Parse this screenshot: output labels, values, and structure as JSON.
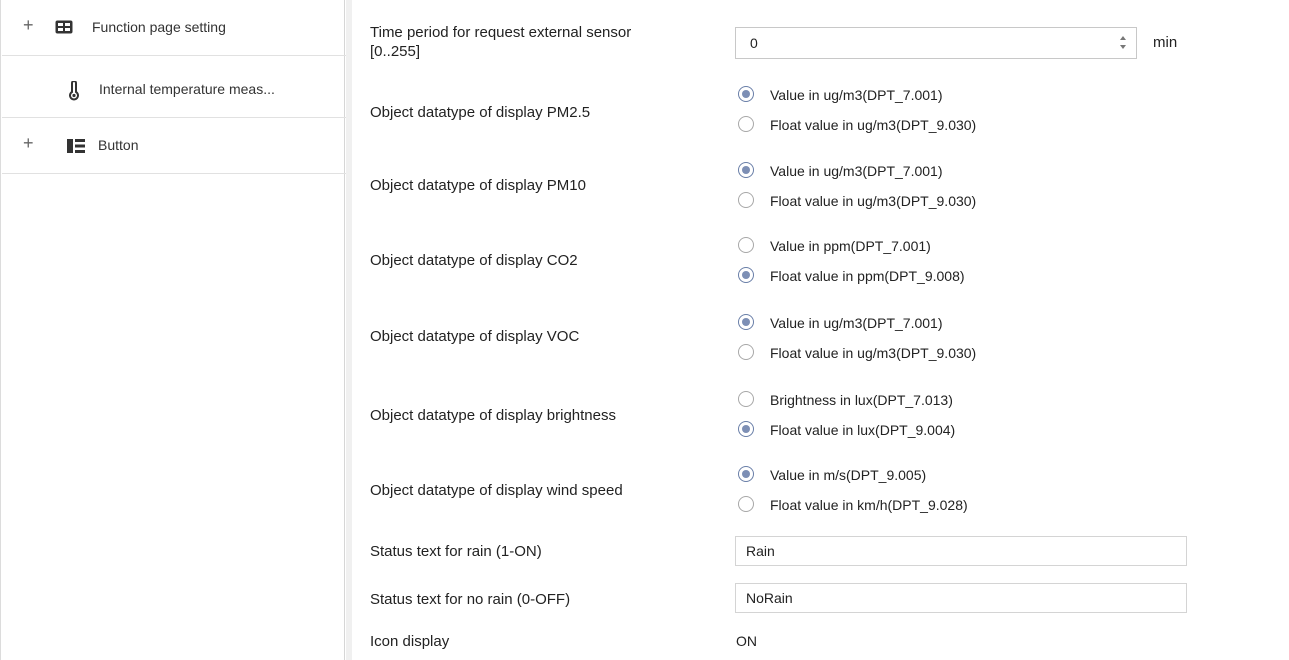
{
  "sidebar": {
    "items": [
      {
        "label": "Function page setting",
        "expander": "+",
        "icon": "grid-icon"
      },
      {
        "label": "Internal temperature meas...",
        "expander": "",
        "icon": "thermometer-icon"
      },
      {
        "label": "Button",
        "expander": "+",
        "icon": "layout-icon"
      }
    ]
  },
  "form": {
    "request_period": {
      "label_line1": "Time period for request external sensor",
      "label_line2": "[0..255]",
      "value": "0",
      "unit": "min"
    },
    "pm25": {
      "label": "Object datatype of display PM2.5",
      "options": [
        "Value in ug/m3(DPT_7.001)",
        "Float value in ug/m3(DPT_9.030)"
      ],
      "selected": 0
    },
    "pm10": {
      "label": "Object datatype of display PM10",
      "options": [
        "Value in ug/m3(DPT_7.001)",
        "Float value in ug/m3(DPT_9.030)"
      ],
      "selected": 0
    },
    "co2": {
      "label": "Object datatype of display CO2",
      "options": [
        "Value in ppm(DPT_7.001)",
        "Float value in ppm(DPT_9.008)"
      ],
      "selected": 1
    },
    "voc": {
      "label": "Object datatype of display VOC",
      "options": [
        "Value in ug/m3(DPT_7.001)",
        "Float value in ug/m3(DPT_9.030)"
      ],
      "selected": 0
    },
    "brightness": {
      "label": "Object datatype of display brightness",
      "options": [
        "Brightness in lux(DPT_7.013)",
        "Float value in lux(DPT_9.004)"
      ],
      "selected": 1
    },
    "wind": {
      "label": "Object datatype of display wind speed",
      "options": [
        "Value in m/s(DPT_9.005)",
        "Float value in km/h(DPT_9.028)"
      ],
      "selected": 0
    },
    "rain_on": {
      "label": "Status text for rain (1-ON)",
      "value": "Rain"
    },
    "rain_off": {
      "label": "Status text for no rain (0-OFF)",
      "value": "NoRain"
    },
    "icon_display": {
      "label": "Icon display",
      "value": "ON"
    }
  },
  "colors": {
    "radio_selected": "#7d8fb5",
    "border": "#d4d4d4"
  }
}
